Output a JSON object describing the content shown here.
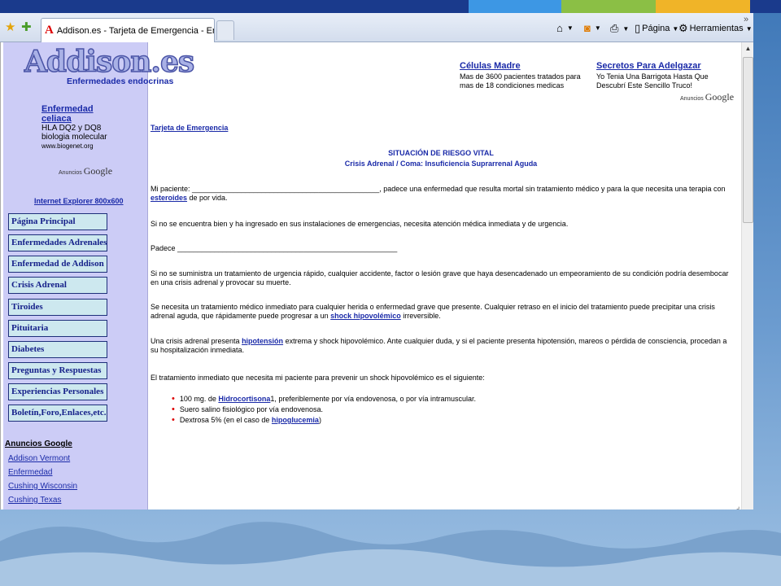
{
  "colors": {
    "stripe_blue": "#1a3a8c",
    "stripe_light_blue": "#3d97e4",
    "stripe_green": "#8bbf45",
    "stripe_yellow": "#f0b428",
    "sidebar_bg": "#ccccf6",
    "link": "#1a2aa8",
    "bullet": "#dd0000"
  },
  "browser": {
    "tab_title": "Addison.es - Tarjeta de Emergencia - Enfermeda...",
    "tab_favicon_letter": "A",
    "commands": {
      "page_label": "Página",
      "tools_label": "Herramientas"
    },
    "overflow_chevron": "»"
  },
  "site": {
    "logo": "Addison.es",
    "logo_subtitle": "Enfermedades endocrinas"
  },
  "sidebar": {
    "ad": {
      "title_line1": "Enfermedad",
      "title_line2": "celiaca",
      "line1": "HLA DQ2 y DQ8",
      "line2": "biologia molecular",
      "url": "www.biogenet.org"
    },
    "anuncios_label": "Anuncios",
    "google_label": "Google",
    "ie_link": "Internet Explorer 800x600",
    "nav": [
      "Página Principal",
      "Enfermedades Adrenales",
      "Enfermedad de Addison",
      "Crisis Adrenal",
      "Tiroides",
      "Pituitaria",
      "Diabetes",
      "Preguntas y Respuestas",
      "Experiencias Personales",
      "Boletín,Foro,Enlaces,etc."
    ],
    "google_ads_title": "Anuncios Google",
    "google_ads": [
      "Addison Vermont",
      "Enfermedad",
      "Cushing Wisconsin",
      "Cushing Texas"
    ]
  },
  "top_ads": [
    {
      "title": "Células Madre",
      "line1": "Mas de 3600 pacientes tratados para",
      "line2": "mas de 18 condiciones medicas"
    },
    {
      "title": "Secretos Para Adelgazar",
      "line1": "Yo Tenia Una Barrigota Hasta Que",
      "line2": "Descubrí Este Sencillo Truco!"
    }
  ],
  "content": {
    "breadcrumb": "Tarjeta de Emergencia",
    "heading1": "SITUACIÓN DE RIESGO VITAL",
    "heading2": "Crisis Adrenal / Coma: Insuficiencia Suprarrenal Aguda",
    "p1_a": "Mi paciente: ______________________________________________, padece una enfermedad que resulta mortal sin tratamiento médico y para la que necesita una terapia con ",
    "p1_link": "esteroides",
    "p1_b": " de por vida.",
    "p2": "Si no se encuentra bien y ha ingresado en sus instalaciones de emergencias, necesita atención médica inmediata y de urgencia.",
    "p3": "Padece ______________________________________________________",
    "p4": "Si no se suministra un tratamiento de urgencia rápido, cualquier accidente, factor o lesión grave que haya desencadenado un empeoramiento de su condición podría desembocar en una crisis adrenal y provocar su muerte.",
    "p5_a": "Se necesita un tratamiento médico inmediato para cualquier herida o enfermedad grave que presente. Cualquier retraso en el inicio del tratamiento puede precipitar una crisis adrenal aguda, que rápidamente puede progresar a un ",
    "p5_link": "shock hipovolémico",
    "p5_b": " irreversible.",
    "p6_a": "Una crisis adrenal presenta ",
    "p6_link": "hipotensión",
    "p6_b": " extrema y shock hipovolémico. Ante cualquier duda, y si el paciente presenta hipotensión, mareos o pérdida de consciencia, procedan a su hospitalización inmediata.",
    "p7": "El tratamiento inmediato que necesita mi paciente para prevenir un shock hipovolémico es el siguiente:",
    "b1_a": "100 mg. de ",
    "b1_link": "Hidrocortisona",
    "b1_b": "1, preferiblemente por vía endovenosa, o por vía intramuscular.",
    "b2": "Suero salino fisiológico por vía endovenosa.",
    "b3_a": "Dextrosa 5% (en el caso de ",
    "b3_link": "hipoglucemia",
    "b3_b": ")"
  }
}
